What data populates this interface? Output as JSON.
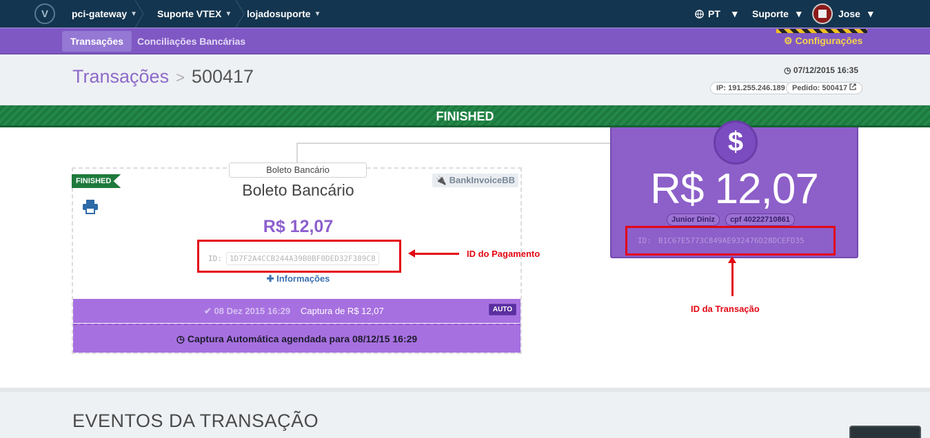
{
  "topbar": {
    "logo": "V",
    "account": "pci-gateway",
    "crumb2": "Suporte VTEX",
    "crumb3": "lojadosuporte",
    "language": "PT",
    "support": "Suporte",
    "user": "Jose"
  },
  "subnav": {
    "tab_transactions": "Transações",
    "tab_reconciliation": "Conciliações Bancárias",
    "settings": "Configurações"
  },
  "header": {
    "title": "Transações",
    "separator": ">",
    "transaction_number": "500417",
    "datetime": "07/12/2015 16:35",
    "ip": "IP: 191.255.246.189",
    "order": "Pedido: 500417"
  },
  "status": "FINISHED",
  "payment": {
    "method_tab": "Boleto Bancário",
    "status_ribbon": "FINISHED",
    "name": "Boleto Bancário",
    "connector": "BankInvoiceBB",
    "amount": "R$ 12,07",
    "id_label": "ID:",
    "id_value": "1D7F2A4CCB244A39B0BF0DED32F389C8",
    "more_info": "Informações",
    "capture_date": "08 Dez 2015 16:29",
    "capture_text": "Captura de R$ 12,07",
    "auto_badge": "AUTO",
    "scheduled": "Captura Automática agendada para 08/12/15 16:29"
  },
  "transaction": {
    "amount": "R$ 12,07",
    "customer_name": "Junior Diniz",
    "customer_doc": "cpf 40222710861",
    "id_label": "ID:",
    "id_value": "B1C67E5773C849AE932476D28DCEFD35"
  },
  "annotations": {
    "payment_id": "ID do Pagamento",
    "transaction_id": "ID da Transação"
  },
  "events": {
    "title": "EVENTOS DA TRANSAÇÃO"
  },
  "colors": {
    "topbar": "#13354f",
    "purple": "#7f58c4",
    "status_green": "#1c7a3e",
    "annotation_red": "#e30613"
  },
  "icons": [
    "vtex-logo-icon",
    "chevron-down-icon",
    "globe-icon",
    "avatar",
    "gear-icon",
    "clock-icon",
    "external-link-icon",
    "plug-icon",
    "print-icon",
    "plus-icon",
    "check-icon",
    "dollar-icon"
  ]
}
